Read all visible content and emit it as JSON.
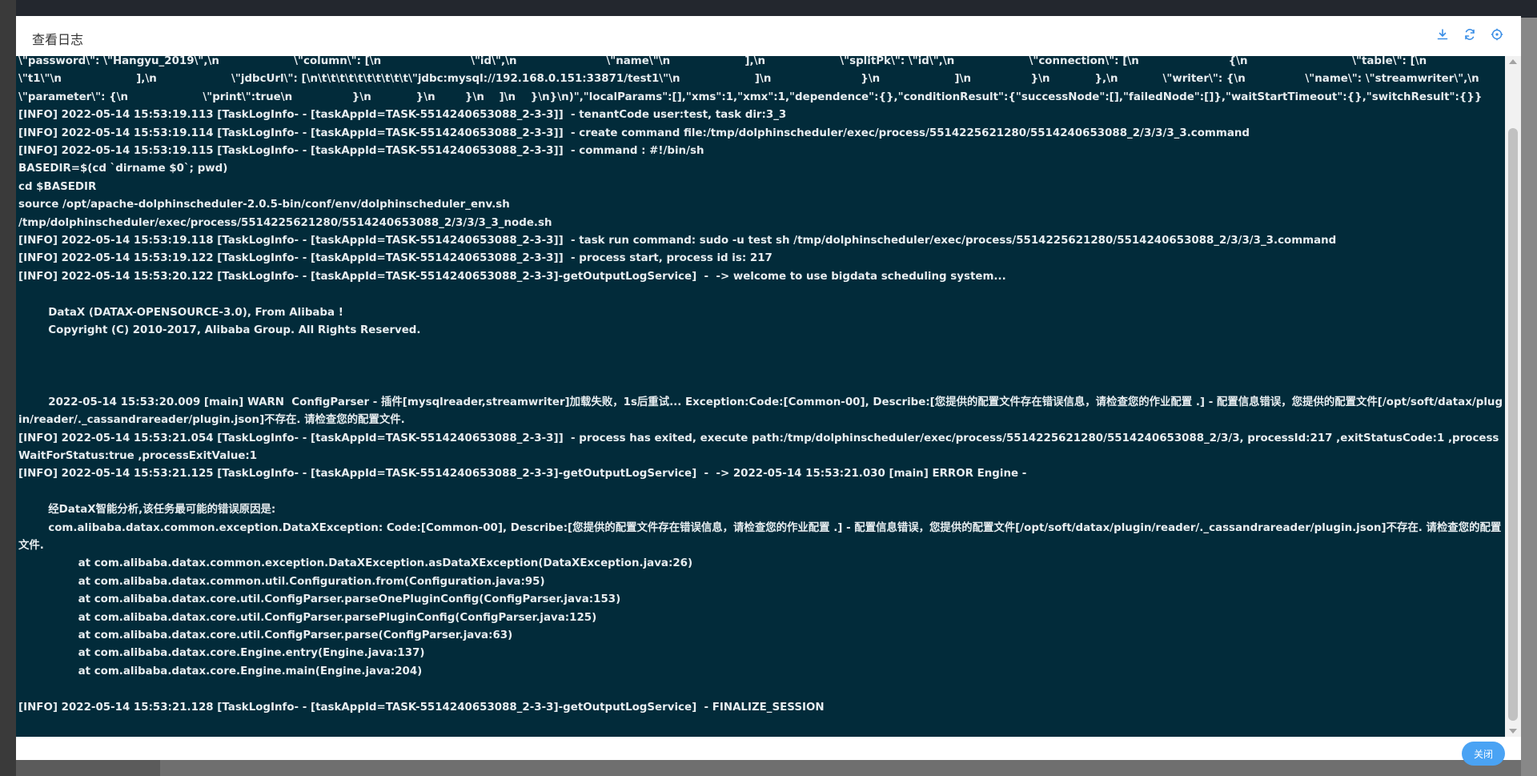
{
  "modal": {
    "title": "查看日志",
    "close_label": "关闭"
  },
  "header_icons": [
    "download-icon",
    "refresh-icon",
    "fullscreen-icon"
  ],
  "colors": {
    "log_background": "#022b3a",
    "log_text": "#e8eef1",
    "accent": "#4aa3f4"
  },
  "log": {
    "lines": [
      "\\\"password\\\": \\\"Hangyu_2019\\\",\\n                    \\\"column\\\": [\\n                        \\\"id\\\",\\n                        \\\"name\\\"\\n                    ],\\n                    \\\"splitPk\\\": \\\"id\\\",\\n                    \\\"connection\\\": [\\n                        {\\n                            \\\"table\\\": [\\n",
      "\\\"t1\\\"\\n                    ],\\n                    \\\"jdbcUrl\\\": [\\n\\t\\t\\t\\t\\t\\t\\t\\t\\t\\t\\\"jdbc:mysql://192.168.0.151:33871/test1\\\"\\n                    ]\\n                        }\\n                    ]\\n                }\\n            },\\n            \\\"writer\\\": {\\n                \\\"name\\\": \\\"streamwriter\\\",\\n                \\\"parameter\\\": {\\n                    \\\"print\\\":true\\n                }\\n            }\\n        }\\n    ]\\n    }\\n}\\n)\",\"localParams\":[],\"xms\":1,\"xmx\":1,\"dependence\":{},\"conditionResult\":{\"successNode\":[],\"failedNode\":[]},\"waitStartTimeout\":{},\"switchResult\":{}}",
      "[INFO] 2022-05-14 15:53:19.113 [TaskLogInfo- - [taskAppId=TASK-5514240653088_2-3-3]]  - tenantCode user:test, task dir:3_3",
      "[INFO] 2022-05-14 15:53:19.114 [TaskLogInfo- - [taskAppId=TASK-5514240653088_2-3-3]]  - create command file:/tmp/dolphinscheduler/exec/process/5514225621280/5514240653088_2/3/3/3_3.command",
      "[INFO] 2022-05-14 15:53:19.115 [TaskLogInfo- - [taskAppId=TASK-5514240653088_2-3-3]]  - command : #!/bin/sh",
      "BASEDIR=$(cd `dirname $0`; pwd)",
      "cd $BASEDIR",
      "source /opt/apache-dolphinscheduler-2.0.5-bin/conf/env/dolphinscheduler_env.sh",
      "/tmp/dolphinscheduler/exec/process/5514225621280/5514240653088_2/3/3/3_3_node.sh",
      "[INFO] 2022-05-14 15:53:19.118 [TaskLogInfo- - [taskAppId=TASK-5514240653088_2-3-3]]  - task run command: sudo -u test sh /tmp/dolphinscheduler/exec/process/5514225621280/5514240653088_2/3/3/3_3.command",
      "[INFO] 2022-05-14 15:53:19.122 [TaskLogInfo- - [taskAppId=TASK-5514240653088_2-3-3]]  - process start, process id is: 217",
      "[INFO] 2022-05-14 15:53:20.122 [TaskLogInfo- - [taskAppId=TASK-5514240653088_2-3-3]-getOutputLogService]  -  -> welcome to use bigdata scheduling system...",
      "",
      "        DataX (DATAX-OPENSOURCE-3.0), From Alibaba !",
      "        Copyright (C) 2010-2017, Alibaba Group. All Rights Reserved.",
      "",
      "",
      "",
      "        2022-05-14 15:53:20.009 [main] WARN  ConfigParser - 插件[mysqlreader,streamwriter]加载失败，1s后重试... Exception:Code:[Common-00], Describe:[您提供的配置文件存在错误信息，请检查您的作业配置 .] - 配置信息错误，您提供的配置文件[/opt/soft/datax/plugin/reader/._cassandrareader/plugin.json]不存在. 请检查您的配置文件.",
      "[INFO] 2022-05-14 15:53:21.054 [TaskLogInfo- - [taskAppId=TASK-5514240653088_2-3-3]]  - process has exited, execute path:/tmp/dolphinscheduler/exec/process/5514225621280/5514240653088_2/3/3, processId:217 ,exitStatusCode:1 ,processWaitForStatus:true ,processExitValue:1",
      "[INFO] 2022-05-14 15:53:21.125 [TaskLogInfo- - [taskAppId=TASK-5514240653088_2-3-3]-getOutputLogService]  -  -> 2022-05-14 15:53:21.030 [main] ERROR Engine -",
      "",
      "        经DataX智能分析,该任务最可能的错误原因是:",
      "        com.alibaba.datax.common.exception.DataXException: Code:[Common-00], Describe:[您提供的配置文件存在错误信息，请检查您的作业配置 .] - 配置信息错误，您提供的配置文件[/opt/soft/datax/plugin/reader/._cassandrareader/plugin.json]不存在. 请检查您的配置文件.",
      "                at com.alibaba.datax.common.exception.DataXException.asDataXException(DataXException.java:26)",
      "                at com.alibaba.datax.common.util.Configuration.from(Configuration.java:95)",
      "                at com.alibaba.datax.core.util.ConfigParser.parseOnePluginConfig(ConfigParser.java:153)",
      "                at com.alibaba.datax.core.util.ConfigParser.parsePluginConfig(ConfigParser.java:125)",
      "                at com.alibaba.datax.core.util.ConfigParser.parse(ConfigParser.java:63)",
      "                at com.alibaba.datax.core.Engine.entry(Engine.java:137)",
      "                at com.alibaba.datax.core.Engine.main(Engine.java:204)",
      "",
      "[INFO] 2022-05-14 15:53:21.128 [TaskLogInfo- - [taskAppId=TASK-5514240653088_2-3-3]-getOutputLogService]  - FINALIZE_SESSION"
    ]
  }
}
